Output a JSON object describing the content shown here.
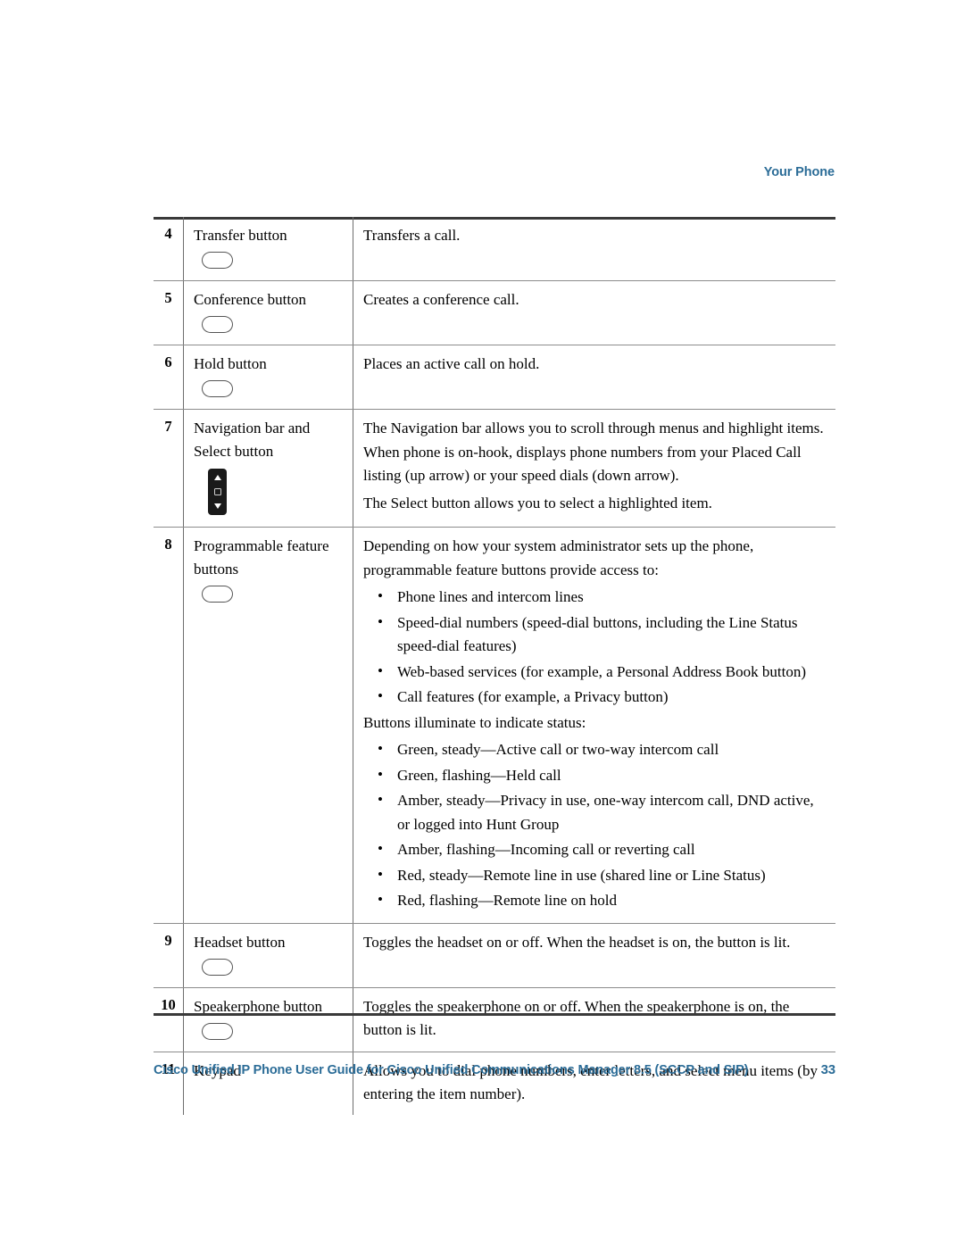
{
  "header": {
    "running_head": "Your Phone"
  },
  "colors": {
    "accent_blue": "#2b6c97",
    "rule_dark": "#3a3a3a",
    "rule_light": "#8c8c8c",
    "nav_icon_body": "#1a1a1a"
  },
  "table": {
    "rows": [
      {
        "num": "4",
        "name": "Transfer button",
        "icon": "rounded-button-icon",
        "desc": [
          "Transfers a call."
        ]
      },
      {
        "num": "5",
        "name": "Conference button",
        "icon": "rounded-button-icon",
        "desc": [
          "Creates a conference call."
        ]
      },
      {
        "num": "6",
        "name": "Hold button",
        "icon": "rounded-button-icon",
        "desc": [
          "Places an active call on hold."
        ]
      },
      {
        "num": "7",
        "name_line1": "Navigation bar and",
        "name_line2": "Select button",
        "icon": "navigation-bar-icon",
        "desc": [
          "The Navigation bar allows you to scroll through menus and highlight items. When phone is on-hook, displays phone numbers from your Placed Call listing (up arrow) or your speed dials (down arrow).",
          "The Select button allows you to select a highlighted item."
        ]
      },
      {
        "num": "8",
        "name_line1": "Programmable feature",
        "name_line2": "buttons",
        "icon": "rounded-button-icon",
        "intro": "Depending on how your system administrator sets up the phone, programmable feature buttons provide access to:",
        "access_bullets": [
          "Phone lines and intercom lines",
          "Speed-dial numbers (speed-dial buttons, including the Line Status speed-dial features)",
          "Web-based services (for example, a Personal Address Book button)",
          "Call features (for example, a Privacy button)"
        ],
        "status_intro": "Buttons illuminate to indicate status:",
        "status_bullets": [
          "Green, steady—Active call or two-way intercom call",
          "Green, flashing—Held call",
          "Amber, steady—Privacy in use, one-way intercom call, DND active, or logged into Hunt Group",
          "Amber, flashing—Incoming call or reverting call",
          "Red, steady—Remote line in use (shared line or Line Status)",
          "Red, flashing—Remote line on hold"
        ]
      },
      {
        "num": "9",
        "name": "Headset button",
        "icon": "rounded-button-icon",
        "desc": [
          "Toggles the headset on or off. When the headset is on, the button is lit."
        ]
      },
      {
        "num": "10",
        "name": "Speakerphone button",
        "icon": "rounded-button-icon",
        "desc": [
          "Toggles the speakerphone on or off. When the speakerphone is on, the button is lit."
        ]
      },
      {
        "num": "11",
        "name": "Keypad",
        "icon": null,
        "desc": [
          "Allows you to dial phone numbers, enter letters, and select menu items (by entering the item number)."
        ]
      }
    ]
  },
  "footer": {
    "guide_title": "Cisco Unified IP Phone User Guide for Cisco Unified Communications Manager 8.5 (SCCP and SIP)",
    "page_number": "33"
  }
}
